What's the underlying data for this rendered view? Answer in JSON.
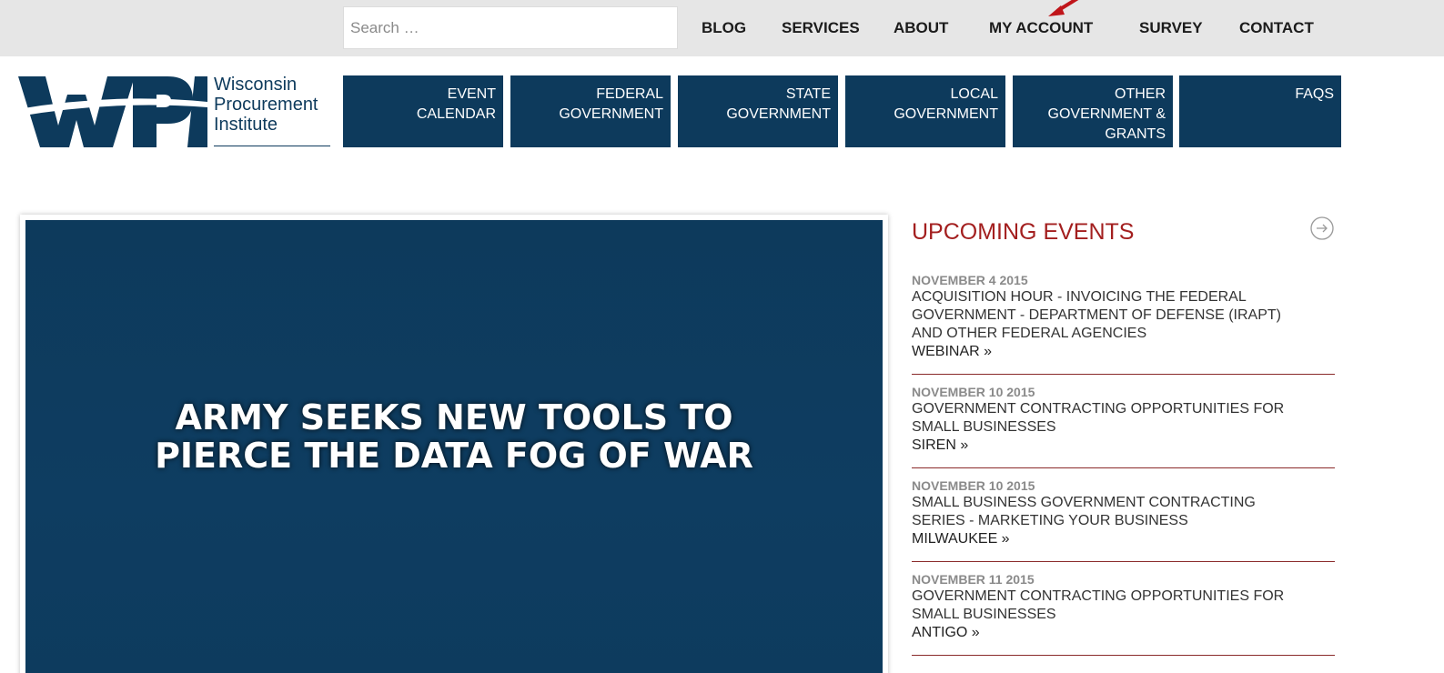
{
  "search": {
    "placeholder": "Search …"
  },
  "top_nav": {
    "blog": "BLOG",
    "services": "SERVICES",
    "about": "ABOUT",
    "my_account": "MY ACCOUNT",
    "survey": "SURVEY",
    "contact": "CONTACT"
  },
  "logo": {
    "mark": "WPI",
    "line1": "Wisconsin",
    "line2": "Procurement",
    "line3": "Institute"
  },
  "main_nav": {
    "event_calendar": [
      "EVENT",
      "CALENDAR"
    ],
    "federal": [
      "FEDERAL",
      "GOVERNMENT"
    ],
    "state": [
      "STATE",
      "GOVERNMENT"
    ],
    "local": [
      "LOCAL",
      "GOVERNMENT"
    ],
    "other": [
      "OTHER",
      "GOVERNMENT &",
      "GRANTS"
    ],
    "faqs": [
      "FAQS"
    ]
  },
  "hero": {
    "title": "ARMY SEEKS NEW TOOLS TO PIERCE THE DATA FOG OF WAR"
  },
  "events": {
    "heading": "UPCOMING EVENTS",
    "more_icon": "circle-arrow-right-icon",
    "items": [
      {
        "date": "NOVEMBER 4 2015",
        "title_lines": [
          "ACQUISITION HOUR - INVOICING THE FEDERAL",
          "GOVERNMENT - DEPARTMENT OF DEFENSE (IRAPT)",
          "AND OTHER FEDERAL AGENCIES"
        ],
        "location": "WEBINAR »"
      },
      {
        "date": "NOVEMBER 10 2015",
        "title_lines": [
          "GOVERNMENT CONTRACTING OPPORTUNITIES FOR",
          "SMALL BUSINESSES"
        ],
        "location": "SIREN »"
      },
      {
        "date": "NOVEMBER 10 2015",
        "title_lines": [
          "SMALL BUSINESS GOVERNMENT CONTRACTING",
          "SERIES - MARKETING YOUR BUSINESS"
        ],
        "location": "MILWAUKEE »"
      },
      {
        "date": "NOVEMBER 11 2015",
        "title_lines": [
          "GOVERNMENT CONTRACTING OPPORTUNITIES FOR",
          "SMALL BUSINESSES"
        ],
        "location": "ANTIGO »"
      }
    ]
  },
  "colors": {
    "navy": "#0d3a5c",
    "topbar": "#e6e6e6",
    "heading_red": "#a31f1f",
    "annotation_arrow": "#c0151a"
  }
}
